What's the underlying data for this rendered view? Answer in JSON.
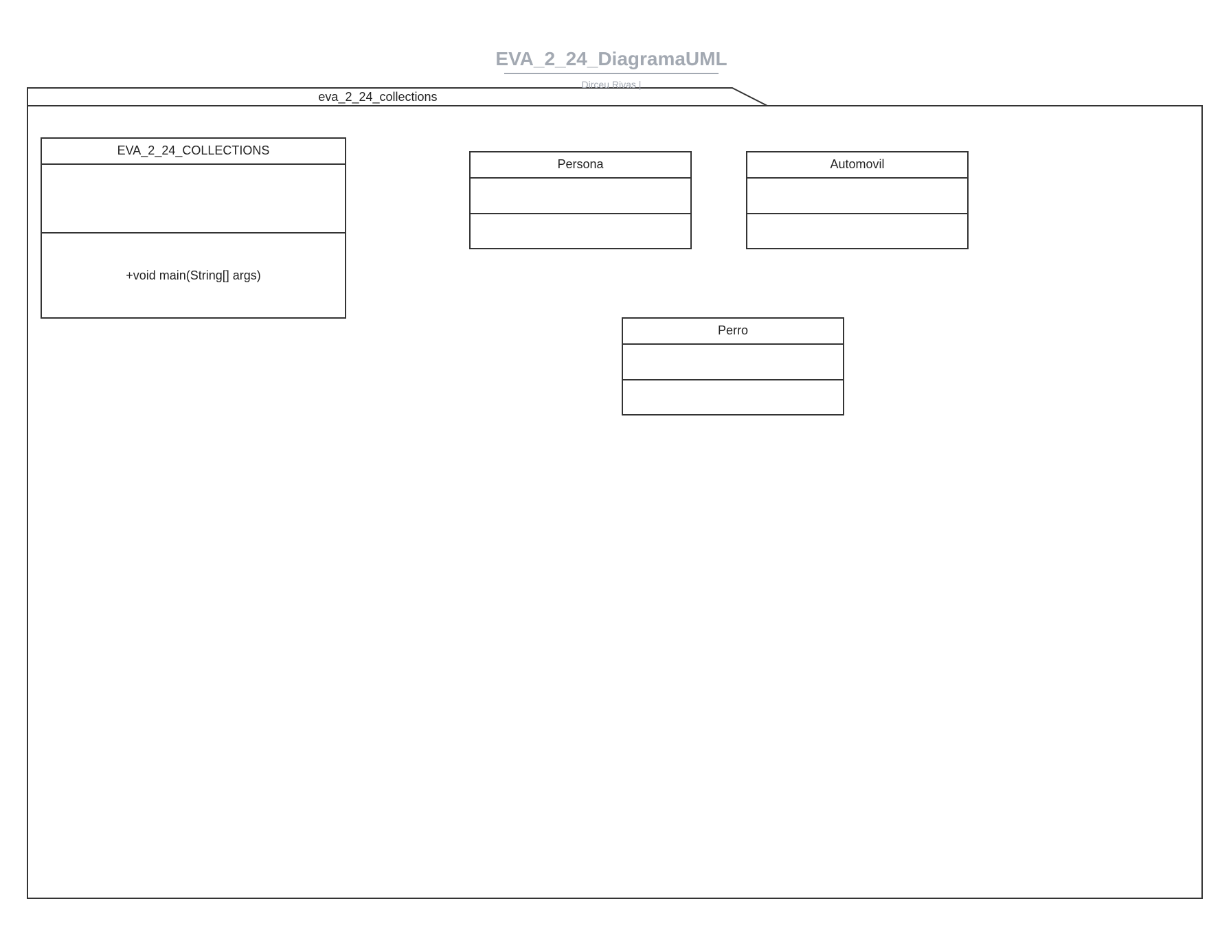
{
  "document": {
    "title": "EVA_2_24_DiagramaUML",
    "author": "Dirceu Rivas  |"
  },
  "package": {
    "name": "eva_2_24_collections"
  },
  "classes": [
    {
      "name": "EVA_2_24_COLLECTIONS",
      "attributes": [],
      "methods": [
        "+void main(String[] args)"
      ]
    },
    {
      "name": "Persona",
      "attributes": [],
      "methods": []
    },
    {
      "name": "Automovil",
      "attributes": [],
      "methods": []
    },
    {
      "name": "Perro",
      "attributes": [],
      "methods": []
    }
  ],
  "colors": {
    "stroke": "#333333",
    "title": "#a3a9b2",
    "background": "#ffffff"
  }
}
